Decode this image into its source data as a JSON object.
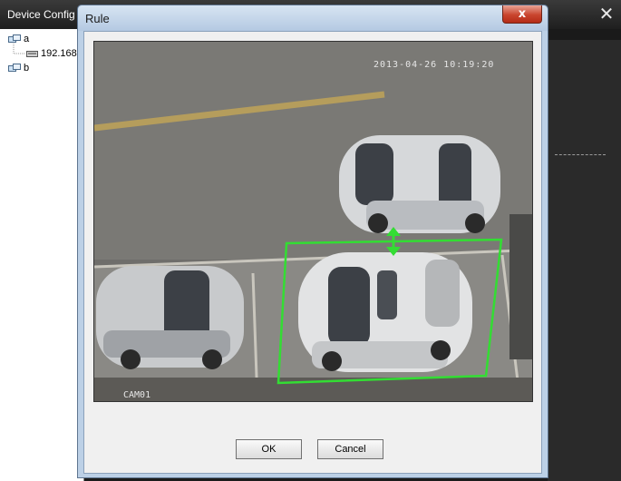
{
  "app": {
    "title": "Device Config"
  },
  "tree": {
    "nodes": [
      {
        "label": "a"
      },
      {
        "label": "192.168"
      },
      {
        "label": "b"
      }
    ]
  },
  "dialog": {
    "title": "Rule",
    "close_label": "x",
    "ok_label": "OK",
    "cancel_label": "Cancel"
  },
  "video": {
    "timestamp": "2013-04-26 10:19:20",
    "camera_label": "CAM01",
    "rule_color": "#33dd33"
  }
}
